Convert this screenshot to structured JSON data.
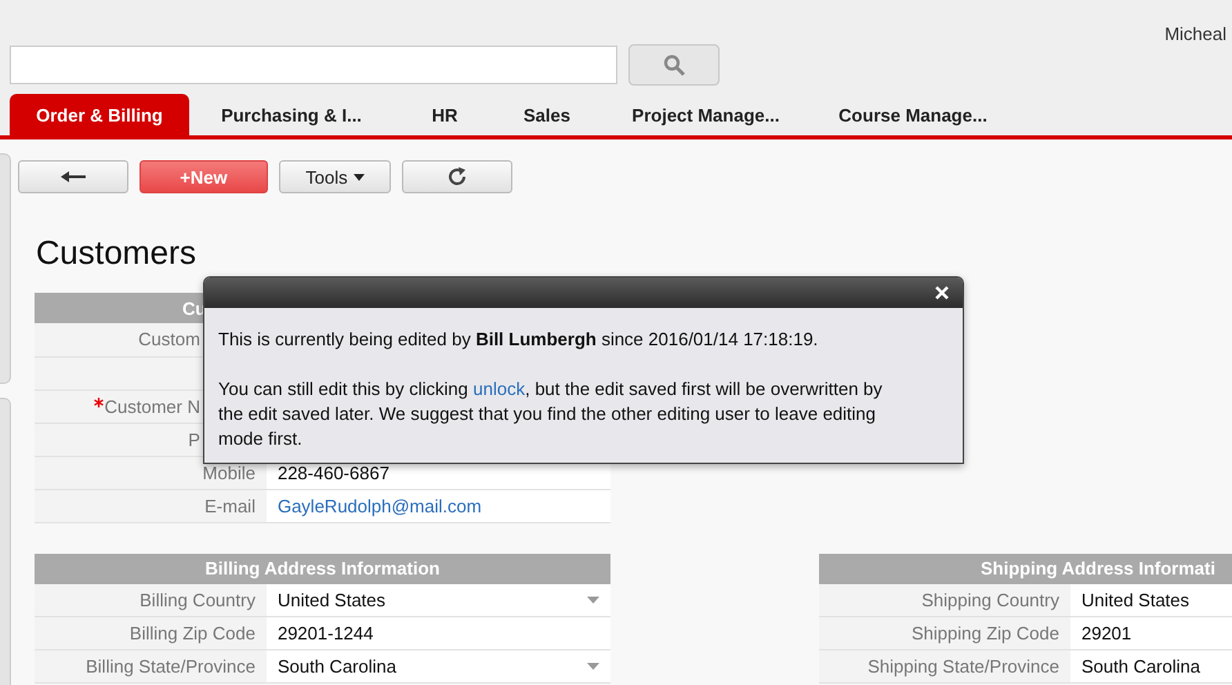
{
  "user": "Micheal",
  "tabs": [
    {
      "label": "Order & Billing",
      "selected": true
    },
    {
      "label": "Purchasing & I...",
      "selected": false
    },
    {
      "label": "HR",
      "selected": false
    },
    {
      "label": "Sales",
      "selected": false
    },
    {
      "label": "Project Manage...",
      "selected": false
    },
    {
      "label": "Course Manage...",
      "selected": false
    }
  ],
  "toolbar": [
    {
      "kind": "back"
    },
    {
      "kind": "new",
      "label": "+New"
    },
    {
      "kind": "tools",
      "label": "Tools"
    },
    {
      "kind": "refresh"
    }
  ],
  "page_title": "Customers",
  "personal": {
    "title": "Cu",
    "rows": [
      {
        "label": "Custom",
        "required": false
      },
      {
        "required": false
      },
      {
        "label": "Customer N",
        "required": true
      },
      {
        "label": "P",
        "required": false
      },
      {
        "label": "Mobile",
        "required": false,
        "kind": "text",
        "value": "228-460-6867"
      },
      {
        "label": "E-mail",
        "required": false,
        "kind": "link",
        "value": "GayleRudolph@mail.com"
      }
    ]
  },
  "billing": {
    "title": "Billing Address Information",
    "rows": [
      {
        "label": "Billing Country",
        "kind": "select",
        "value": "United States"
      },
      {
        "label": "Billing Zip Code",
        "kind": "text",
        "value": "29201-1244"
      },
      {
        "label": "Billing State/Province",
        "kind": "select",
        "value": "South Carolina"
      }
    ]
  },
  "shipping": {
    "title": "Shipping Address Informati",
    "rows": [
      {
        "label": "Shipping Country",
        "kind": "text",
        "value": "United States"
      },
      {
        "label": "Shipping Zip Code",
        "kind": "text",
        "value": "29201"
      },
      {
        "label": "Shipping State/Province",
        "kind": "text",
        "value": "South Carolina"
      }
    ]
  },
  "dialog": {
    "message": "This is currently being edited by **Bill Lumbergh** since 2016/01/14 17:18:19.",
    "note_before": "You can still edit this by clicking ",
    "link": "unlock",
    "note_after": ", but the edit saved first will be overwritten by the edit saved later. We suggest that you find the other editing user to leave editing mode first."
  }
}
